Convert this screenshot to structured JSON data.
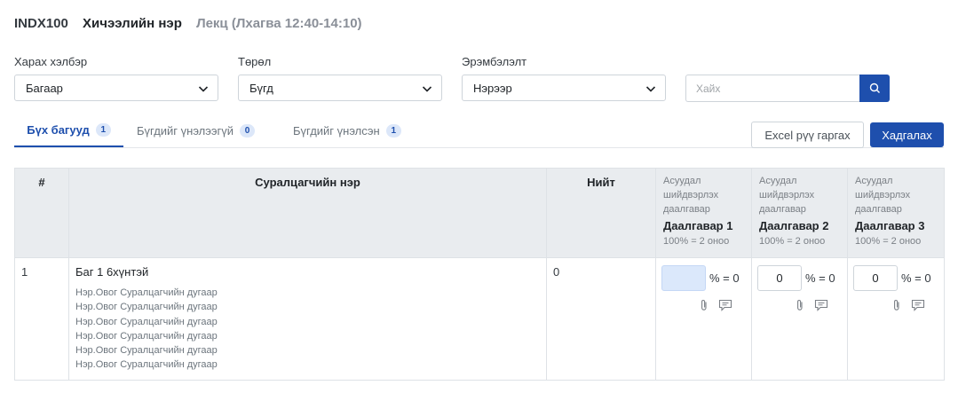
{
  "header": {
    "course_code": "INDX100",
    "course_name": "Хичээлийн нэр",
    "lesson": "Лекц (Лхагва 12:40-14:10)"
  },
  "filters": {
    "view": {
      "label": "Харах хэлбэр",
      "value": "Багаар"
    },
    "type": {
      "label": "Төрөл",
      "value": "Бүгд"
    },
    "sort": {
      "label": "Эрэмбэлэлт",
      "value": "Нэрээр"
    },
    "search": {
      "placeholder": "Хайх"
    }
  },
  "tabs": [
    {
      "label": "Бүх багууд",
      "count": "1"
    },
    {
      "label": "Бүгдийг үнэлээгүй",
      "count": "0"
    },
    {
      "label": "Бүгдийг үнэлсэн",
      "count": "1"
    }
  ],
  "actions": {
    "excel": "Excel рүү гаргах",
    "save": "Хадгалах"
  },
  "table": {
    "headers": {
      "num": "#",
      "student": "Суралцагчийн нэр",
      "total": "Нийт"
    },
    "tasks": [
      {
        "desc": "Асуудал шийдвэрлэх даалгавар",
        "name": "Даалгавар 1",
        "points": "100% = 2 оноо"
      },
      {
        "desc": "Асуудал шийдвэрлэх даалгавар",
        "name": "Даалгавар 2",
        "points": "100% = 2 оноо"
      },
      {
        "desc": "Асуудал шийдвэрлэх даалгавар",
        "name": "Даалгавар 3",
        "points": "100% = 2 оноо"
      }
    ],
    "rows": [
      {
        "num": "1",
        "team": "Баг 1 6хүнтэй",
        "members": [
          "Нэр.Овог Суралцагчийн дугаар",
          "Нэр.Овог Суралцагчийн дугаар",
          "Нэр.Овог Суралцагчийн дугаар",
          "Нэр.Овог Суралцагчийн дугаар",
          "Нэр.Овог Суралцагчийн дугаар",
          "Нэр.Овог Суралцагчийн дугаар"
        ],
        "total": "0",
        "scores": [
          {
            "value": "",
            "suffix": "% = 0"
          },
          {
            "value": "0",
            "suffix": "% = 0"
          },
          {
            "value": "0",
            "suffix": "% = 0"
          }
        ]
      }
    ]
  },
  "colors": {
    "primary": "#1e4fad",
    "header_bg": "#e9ecef",
    "badge_bg": "#dce7f9"
  },
  "icons": [
    "chevron-down-icon",
    "search-icon",
    "paperclip-icon",
    "comment-icon"
  ]
}
